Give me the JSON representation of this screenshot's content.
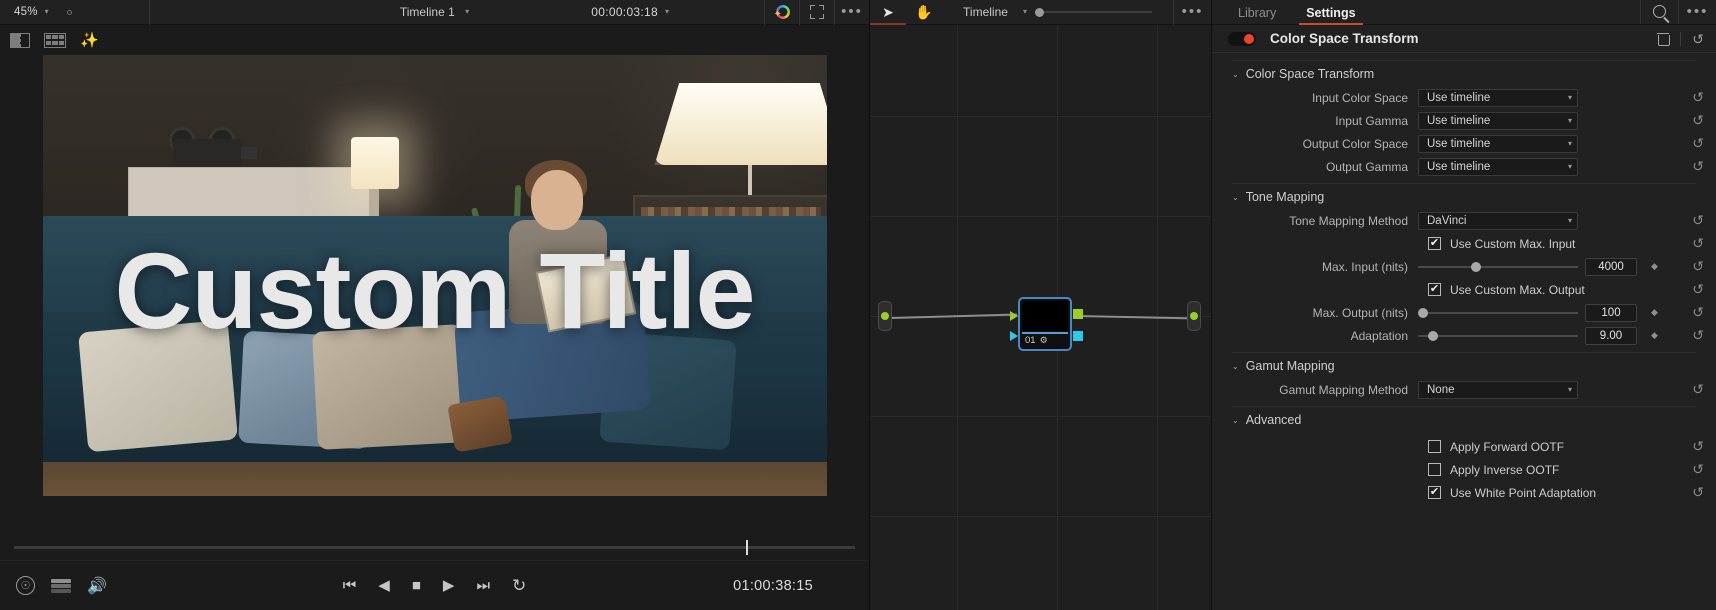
{
  "viewer": {
    "zoom": "45%",
    "timeline_name": "Timeline 1",
    "timecode": "00:00:03:18",
    "current_timecode": "01:00:38:15",
    "title_overlay": "Custom Title",
    "icons": {
      "zoom_chevron": "chevron-down-icon",
      "record_dot": "record-dot-icon",
      "magic_ai": "ai-magic-icon",
      "expand": "expand-icon",
      "options": "more-options-icon",
      "split_screen": "split-screen-icon",
      "grid_view": "grid-view-icon",
      "wand": "magic-wand-icon",
      "bypass": "bypass-color-icon",
      "stack": "node-stack-icon",
      "audio": "speaker-icon"
    },
    "transport": {
      "jump_start": "⏮",
      "play_reverse": "◀",
      "stop": "■",
      "play_forward": "▶",
      "jump_end": "⏭",
      "loop": "↻"
    }
  },
  "node_editor": {
    "tools": {
      "cursor": "cursor-tool",
      "hand": "hand-tool"
    },
    "mode_label": "Timeline",
    "options_icon": "more-options-icon",
    "node": {
      "number": "01",
      "gear": "⚙"
    }
  },
  "inspector": {
    "tabs": [
      {
        "label": "Library",
        "active": false
      },
      {
        "label": "Settings",
        "active": true
      }
    ],
    "search_icon": "search-icon",
    "options_icon": "more-options-icon",
    "effect": {
      "title": "Color Space Transform",
      "enabled": true,
      "toggle_color": "#e8452a",
      "delete_icon": "trash-icon",
      "reset_icon": "reset-icon"
    },
    "groups": [
      {
        "name": "Color Space Transform",
        "expanded": true,
        "rows": [
          {
            "type": "dropdown",
            "label": "Input Color Space",
            "value": "Use timeline"
          },
          {
            "type": "dropdown",
            "label": "Input Gamma",
            "value": "Use timeline"
          },
          {
            "type": "dropdown",
            "label": "Output Color Space",
            "value": "Use timeline"
          },
          {
            "type": "dropdown",
            "label": "Output Gamma",
            "value": "Use timeline"
          }
        ]
      },
      {
        "name": "Tone Mapping",
        "expanded": true,
        "rows": [
          {
            "type": "dropdown",
            "label": "Tone Mapping Method",
            "value": "DaVinci"
          },
          {
            "type": "checkbox",
            "label": "Use Custom Max. Input",
            "checked": true
          },
          {
            "type": "slider",
            "label": "Max. Input (nits)",
            "value": "4000",
            "pos": 33
          },
          {
            "type": "checkbox",
            "label": "Use Custom Max. Output",
            "checked": true
          },
          {
            "type": "slider",
            "label": "Max. Output (nits)",
            "value": "100",
            "pos": 0
          },
          {
            "type": "slider",
            "label": "Adaptation",
            "value": "9.00",
            "pos": 6
          }
        ]
      },
      {
        "name": "Gamut Mapping",
        "expanded": true,
        "rows": [
          {
            "type": "dropdown",
            "label": "Gamut Mapping Method",
            "value": "None"
          }
        ]
      },
      {
        "name": "Advanced",
        "expanded": true,
        "rows": [
          {
            "type": "checkbox",
            "label": "Apply Forward OOTF",
            "checked": false
          },
          {
            "type": "checkbox",
            "label": "Apply Inverse OOTF",
            "checked": false
          },
          {
            "type": "checkbox",
            "label": "Use White Point Adaptation",
            "checked": true
          }
        ]
      }
    ],
    "reset_glyph": "↺",
    "keyframe_glyph": "◆",
    "chevron_expanded": "⌄",
    "chevron_down": "⌄",
    "check_glyph": "✔"
  }
}
